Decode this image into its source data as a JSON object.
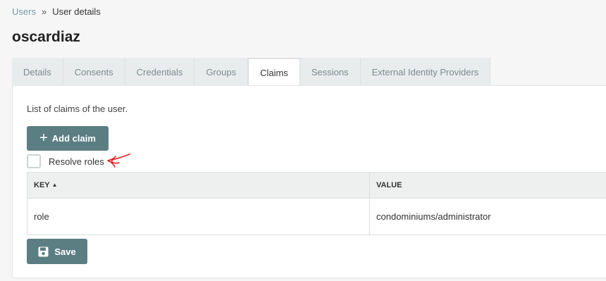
{
  "breadcrumb": {
    "parent": "Users",
    "separator": "»",
    "current": "User details"
  },
  "page": {
    "title": "oscardiaz"
  },
  "tabs": [
    {
      "label": "Details",
      "active": false
    },
    {
      "label": "Consents",
      "active": false
    },
    {
      "label": "Credentials",
      "active": false
    },
    {
      "label": "Groups",
      "active": false
    },
    {
      "label": "Claims",
      "active": true
    },
    {
      "label": "Sessions",
      "active": false
    },
    {
      "label": "External Identity Providers",
      "active": false
    }
  ],
  "claims": {
    "description": "List of claims of the user.",
    "add_button": "Add claim",
    "resolve_roles_label": "Resolve roles",
    "resolve_roles_checked": false,
    "table": {
      "headers": {
        "key": "KEY",
        "value": "VALUE"
      },
      "sort_icon": "sort-ascending-icon",
      "rows": [
        {
          "key": "role",
          "value": "condominiums/administrator"
        }
      ]
    },
    "save_button": "Save"
  },
  "icons": {
    "add": "plus-icon",
    "save": "floppy-disk-icon",
    "annotation": "red-hand-drawn-arrow-icon"
  },
  "colors": {
    "primary_button": "#5b7e83",
    "link": "#7a9aa6",
    "annotation": "#e02020"
  }
}
